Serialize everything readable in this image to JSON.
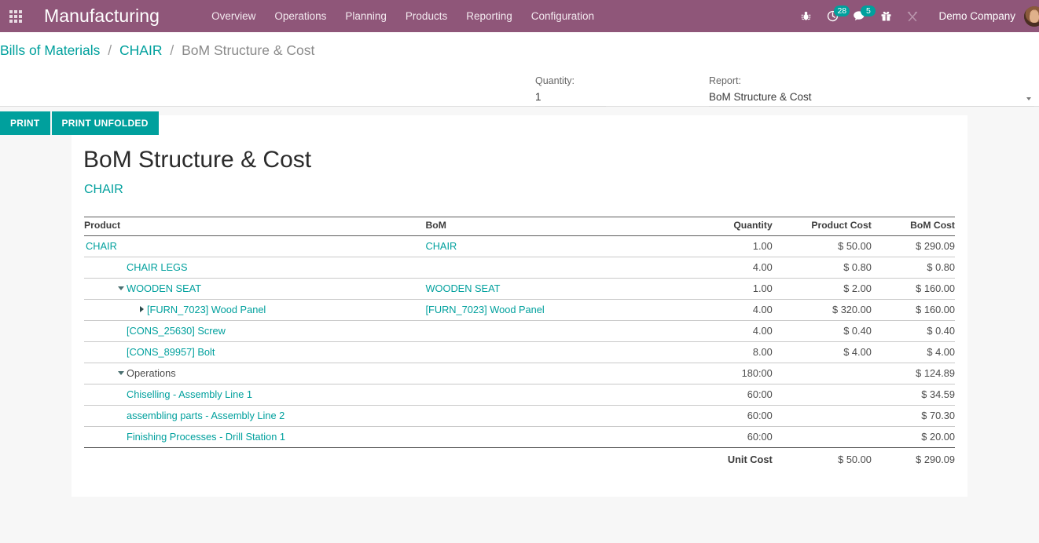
{
  "navbar": {
    "apps_icon": "apps-grid-icon",
    "brand": "Manufacturing",
    "menu": [
      {
        "label": "Overview"
      },
      {
        "label": "Operations"
      },
      {
        "label": "Planning"
      },
      {
        "label": "Products"
      },
      {
        "label": "Reporting"
      },
      {
        "label": "Configuration"
      }
    ],
    "icons": [
      {
        "name": "bug-icon",
        "badge": null
      },
      {
        "name": "activity-clock-icon",
        "badge": "28"
      },
      {
        "name": "messages-chat-icon",
        "badge": "5"
      },
      {
        "name": "gift-icon",
        "badge": null
      },
      {
        "name": "developer-tools-icon",
        "badge": null
      }
    ],
    "company": "Demo Company",
    "avatar": "user-avatar"
  },
  "breadcrumb": {
    "root": "Bills of Materials",
    "parent": "CHAIR",
    "current": "BoM Structure & Cost",
    "separator": "/"
  },
  "buttons": {
    "print": "PRINT",
    "print_unfolded": "PRINT UNFOLDED"
  },
  "fields": {
    "quantity": {
      "label": "Quantity:",
      "value": "1",
      "placeholder": ""
    },
    "report": {
      "label": "Report:",
      "value": "BoM Structure & Cost",
      "caret": "chevron-down-icon"
    }
  },
  "report": {
    "title": "BoM Structure & Cost",
    "subtitle": "CHAIR",
    "columns": {
      "product": "Product",
      "bom": "BoM",
      "quantity": "Quantity",
      "product_cost": "Product Cost",
      "bom_cost": "BoM Cost"
    },
    "rows": [
      {
        "product": "CHAIR",
        "bom": "CHAIR",
        "quantity": "1.00",
        "product_cost": "$ 50.00",
        "bom_cost": "$ 290.09"
      },
      {
        "product": "CHAIR LEGS",
        "bom": "",
        "quantity": "4.00",
        "product_cost": "$ 0.80",
        "bom_cost": "$ 0.80"
      },
      {
        "product": "WOODEN SEAT",
        "bom": "WOODEN SEAT",
        "quantity": "1.00",
        "product_cost": "$ 2.00",
        "bom_cost": "$ 160.00"
      },
      {
        "product": "[FURN_7023] Wood Panel",
        "bom": "[FURN_7023] Wood Panel",
        "quantity": "4.00",
        "product_cost": "$ 320.00",
        "bom_cost": "$ 160.00"
      },
      {
        "product": "[CONS_25630] Screw",
        "bom": "",
        "quantity": "4.00",
        "product_cost": "$ 0.40",
        "bom_cost": "$ 0.40"
      },
      {
        "product": "[CONS_89957] Bolt",
        "bom": "",
        "quantity": "8.00",
        "product_cost": "$ 4.00",
        "bom_cost": "$ 4.00"
      },
      {
        "product": "Operations",
        "bom": "",
        "quantity": "180:00",
        "product_cost": "",
        "bom_cost": "$ 124.89"
      },
      {
        "product": "Chiselling - Assembly Line 1",
        "bom": "",
        "quantity": "60:00",
        "product_cost": "",
        "bom_cost": "$ 34.59"
      },
      {
        "product": "assembling parts - Assembly Line 2",
        "bom": "",
        "quantity": "60:00",
        "product_cost": "",
        "bom_cost": "$ 70.30"
      },
      {
        "product": "Finishing Processes - Drill Station 1",
        "bom": "",
        "quantity": "60:00",
        "product_cost": "",
        "bom_cost": "$ 20.00"
      }
    ],
    "total": {
      "label": "Unit Cost",
      "product_cost": "$ 50.00",
      "bom_cost": "$ 290.09"
    }
  },
  "colors": {
    "navbar": "#8f5679",
    "accent": "#00a09d",
    "link": "#00a09d",
    "badge": "#00a09d",
    "page_bg": "#f7f7f7"
  }
}
